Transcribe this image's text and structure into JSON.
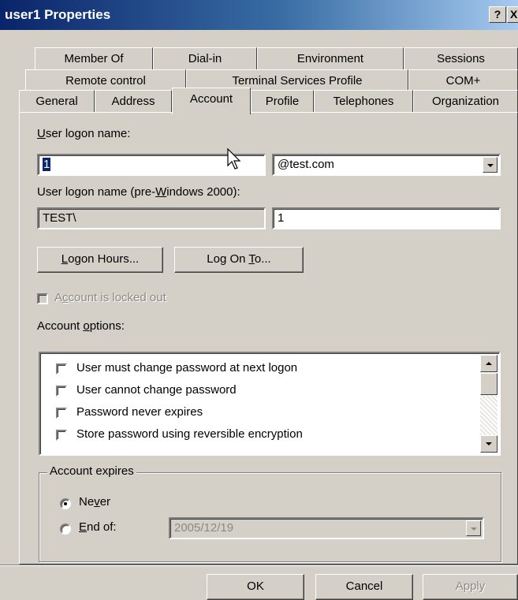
{
  "window": {
    "title": "user1 Properties",
    "help_label": "?",
    "close_label": "X"
  },
  "tabs": {
    "row1": [
      "Member Of",
      "Dial-in",
      "Environment",
      "Sessions"
    ],
    "row2": [
      "Remote control",
      "Terminal Services Profile",
      "COM+"
    ],
    "row3": [
      "General",
      "Address",
      "Account",
      "Profile",
      "Telephones",
      "Organization"
    ],
    "active": "Account"
  },
  "account": {
    "logon_name_label_u": "U",
    "logon_name_label_rest": "ser logon name:",
    "logon_name_value": "1",
    "domain_value": "@test.com",
    "pre2000_label_a": "User logon name (pre-",
    "pre2000_label_u": "W",
    "pre2000_label_b": "indows 2000):",
    "pre2000_domain": "TEST\\",
    "pre2000_user": "1",
    "logon_hours_u": "L",
    "logon_hours_rest": "ogon Hours...",
    "log_on_to_a": "Log On ",
    "log_on_to_u": "T",
    "log_on_to_b": "o...",
    "locked_out_a": "A",
    "locked_out_u": "c",
    "locked_out_b": "count is locked out",
    "options_label_a": "Account ",
    "options_label_u": "o",
    "options_label_b": "ptions:",
    "options": [
      "User must change password at next logon",
      "User cannot change password",
      "Password never expires",
      "Store password using reversible encryption"
    ],
    "expires_label": "Account expires",
    "never_a": "Ne",
    "never_u": "v",
    "never_b": "er",
    "end_of_u": "E",
    "end_of_rest": "nd of:",
    "end_date": "2005/12/19"
  },
  "footer": {
    "ok": "OK",
    "cancel": "Cancel",
    "apply": "Apply"
  }
}
